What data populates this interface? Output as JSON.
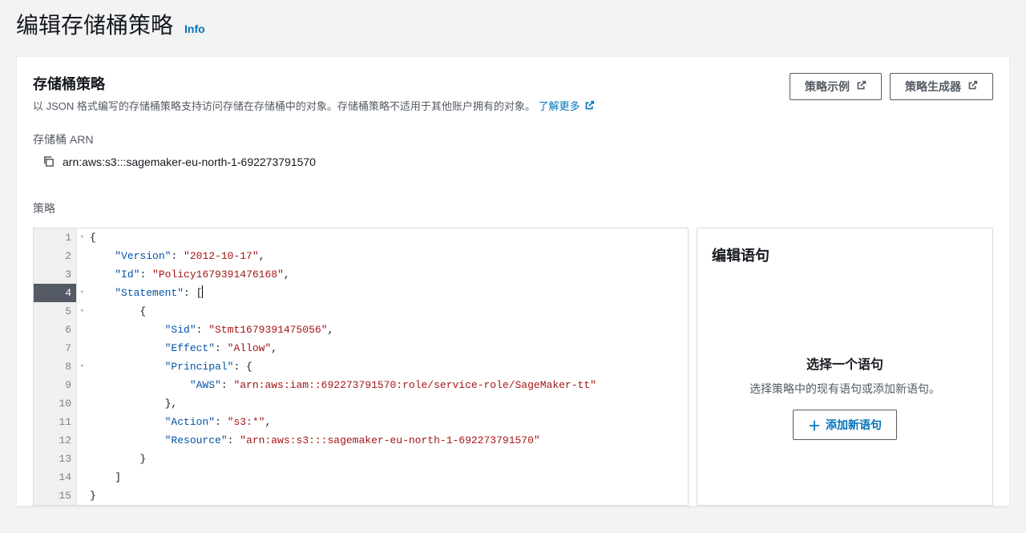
{
  "page": {
    "title": "编辑存储桶策略",
    "info_label": "Info"
  },
  "card": {
    "title": "存储桶策略",
    "description": "以 JSON 格式编写的存储桶策略支持访问存储在存储桶中的对象。存储桶策略不适用于其他账户拥有的对象。",
    "learn_more": "了解更多",
    "buttons": {
      "examples": "策略示例",
      "generator": "策略生成器"
    }
  },
  "arn": {
    "label": "存储桶 ARN",
    "value": "arn:aws:s3:::sagemaker-eu-north-1-692273791570"
  },
  "policy": {
    "label": "策略",
    "active_line": 4,
    "lines": [
      {
        "num": 1,
        "indent": 0,
        "fold": true,
        "tokens": [
          {
            "t": "punc",
            "v": "{"
          }
        ]
      },
      {
        "num": 2,
        "indent": 1,
        "fold": false,
        "tokens": [
          {
            "t": "key",
            "v": "\"Version\""
          },
          {
            "t": "punc",
            "v": ": "
          },
          {
            "t": "str",
            "v": "\"2012-10-17\""
          },
          {
            "t": "punc",
            "v": ","
          }
        ]
      },
      {
        "num": 3,
        "indent": 1,
        "fold": false,
        "tokens": [
          {
            "t": "key",
            "v": "\"Id\""
          },
          {
            "t": "punc",
            "v": ": "
          },
          {
            "t": "str",
            "v": "\"Policy1679391476168\""
          },
          {
            "t": "punc",
            "v": ","
          }
        ]
      },
      {
        "num": 4,
        "indent": 1,
        "fold": true,
        "tokens": [
          {
            "t": "key",
            "v": "\"Statement\""
          },
          {
            "t": "punc",
            "v": ": ["
          },
          {
            "t": "cursor",
            "v": ""
          }
        ]
      },
      {
        "num": 5,
        "indent": 2,
        "fold": true,
        "tokens": [
          {
            "t": "punc",
            "v": "{"
          }
        ]
      },
      {
        "num": 6,
        "indent": 3,
        "fold": false,
        "tokens": [
          {
            "t": "key",
            "v": "\"Sid\""
          },
          {
            "t": "punc",
            "v": ": "
          },
          {
            "t": "str",
            "v": "\"Stmt1679391475056\""
          },
          {
            "t": "punc",
            "v": ","
          }
        ]
      },
      {
        "num": 7,
        "indent": 3,
        "fold": false,
        "tokens": [
          {
            "t": "key",
            "v": "\"Effect\""
          },
          {
            "t": "punc",
            "v": ": "
          },
          {
            "t": "str",
            "v": "\"Allow\""
          },
          {
            "t": "punc",
            "v": ","
          }
        ]
      },
      {
        "num": 8,
        "indent": 3,
        "fold": true,
        "tokens": [
          {
            "t": "key",
            "v": "\"Principal\""
          },
          {
            "t": "punc",
            "v": ": {"
          }
        ]
      },
      {
        "num": 9,
        "indent": 4,
        "fold": false,
        "tokens": [
          {
            "t": "key",
            "v": "\"AWS\""
          },
          {
            "t": "punc",
            "v": ": "
          },
          {
            "t": "str",
            "v": "\"arn:aws:iam::692273791570:role/service-role/SageMaker-tt\""
          }
        ]
      },
      {
        "num": 10,
        "indent": 3,
        "fold": false,
        "tokens": [
          {
            "t": "punc",
            "v": "},"
          }
        ]
      },
      {
        "num": 11,
        "indent": 3,
        "fold": false,
        "tokens": [
          {
            "t": "key",
            "v": "\"Action\""
          },
          {
            "t": "punc",
            "v": ": "
          },
          {
            "t": "str",
            "v": "\"s3:*\""
          },
          {
            "t": "punc",
            "v": ","
          }
        ]
      },
      {
        "num": 12,
        "indent": 3,
        "fold": false,
        "tokens": [
          {
            "t": "key",
            "v": "\"Resource\""
          },
          {
            "t": "punc",
            "v": ": "
          },
          {
            "t": "str",
            "v": "\"arn:aws:s3:::sagemaker-eu-north-1-692273791570\""
          }
        ]
      },
      {
        "num": 13,
        "indent": 2,
        "fold": false,
        "tokens": [
          {
            "t": "punc",
            "v": "}"
          }
        ]
      },
      {
        "num": 14,
        "indent": 1,
        "fold": false,
        "tokens": [
          {
            "t": "punc",
            "v": "]"
          }
        ]
      },
      {
        "num": 15,
        "indent": 0,
        "fold": false,
        "tokens": [
          {
            "t": "punc",
            "v": "}"
          }
        ]
      }
    ]
  },
  "side": {
    "title": "编辑语句",
    "heading": "选择一个语句",
    "sub": "选择策略中的现有语句或添加新语句。",
    "add_btn": "添加新语句"
  }
}
